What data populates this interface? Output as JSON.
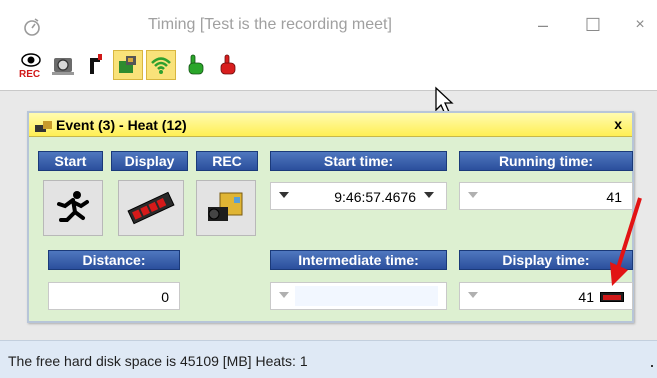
{
  "window": {
    "title": "Timing [Test is the recording meet]",
    "controls": {
      "minimize": "–",
      "maximize": "☐",
      "close": "×"
    }
  },
  "toolbar": {
    "buttons": [
      {
        "icon": "rec-eye-icon",
        "label": "REC"
      },
      {
        "icon": "camera-icon"
      },
      {
        "icon": "start-gun-icon"
      },
      {
        "icon": "hand-signal-icon",
        "selected": true
      },
      {
        "icon": "wireless-icon",
        "selected": true
      },
      {
        "icon": "green-hand-icon"
      },
      {
        "icon": "red-hand-icon"
      }
    ]
  },
  "event_panel": {
    "title": "Event (3) - Heat (12)",
    "close_label": "x",
    "headers": {
      "start": "Start",
      "display": "Display",
      "rec": "REC",
      "start_time": "Start time:",
      "running_time": "Running time:",
      "distance": "Distance:",
      "intermediate_time": "Intermediate time:",
      "display_time": "Display time:"
    },
    "values": {
      "start_time": "9:46:57.4676",
      "running_time": "41",
      "distance": "0",
      "intermediate_time": "",
      "display_time": "41"
    },
    "colors": {
      "header_blue": "#2b4f9c",
      "panel_green": "#ddf0d1",
      "title_yellow": "#ffef54",
      "indicator_red": "#d01818"
    }
  },
  "status_bar": {
    "text": "The free hard disk space is 45109 [MB]  Heats: 1"
  }
}
